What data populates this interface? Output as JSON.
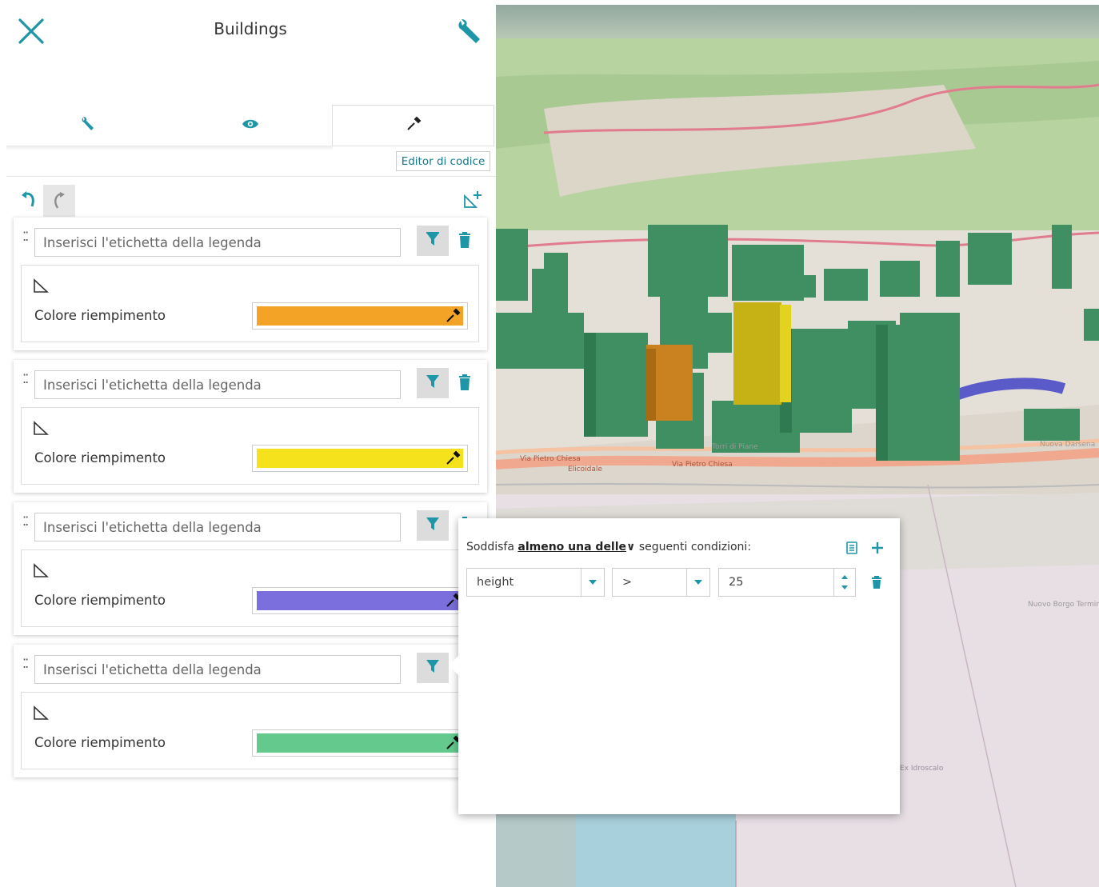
{
  "header": {
    "title": "Buildings",
    "close_icon": "close-icon",
    "tool_icon": "wrench-icon"
  },
  "tabs": [
    {
      "name": "settings",
      "icon": "wrench-icon"
    },
    {
      "name": "display",
      "icon": "eye-icon"
    },
    {
      "name": "style",
      "icon": "eyedropper-icon",
      "active": true
    }
  ],
  "toolbar": {
    "code_editor_label": "Editor di codice"
  },
  "rules": [
    {
      "legend_placeholder": "Inserisci l'etichetta della legenda",
      "fill_label": "Colore riempimento",
      "color": "#f3a427"
    },
    {
      "legend_placeholder": "Inserisci l'etichetta della legenda",
      "fill_label": "Colore riempimento",
      "color": "#f5e21c"
    },
    {
      "legend_placeholder": "Inserisci l'etichetta della legenda",
      "fill_label": "Colore riempimento",
      "color": "#7a6fdc"
    },
    {
      "legend_placeholder": "Inserisci l'etichetta della legenda",
      "fill_label": "Colore riempimento",
      "color": "#64c98d"
    }
  ],
  "filter": {
    "prefix": "Soddisfa",
    "mode": "almeno una delle",
    "suffix": "seguenti condizioni:",
    "condition": {
      "attribute": "height",
      "operator": ">",
      "value": "25"
    }
  },
  "map": {
    "labels": [
      "Via Pietro Chiesa",
      "Elicoidale",
      "Via Pietro Chiesa",
      "Nuova Darsena",
      "Ex Idroscalo",
      "Torri di Piane",
      "Nuovo Borgo Terminal Porto"
    ]
  },
  "colors": {
    "accent": "#1e96a8",
    "building": "#3c8c5f",
    "building_orange": "#c9821f",
    "building_yellow": "#c7b215"
  }
}
